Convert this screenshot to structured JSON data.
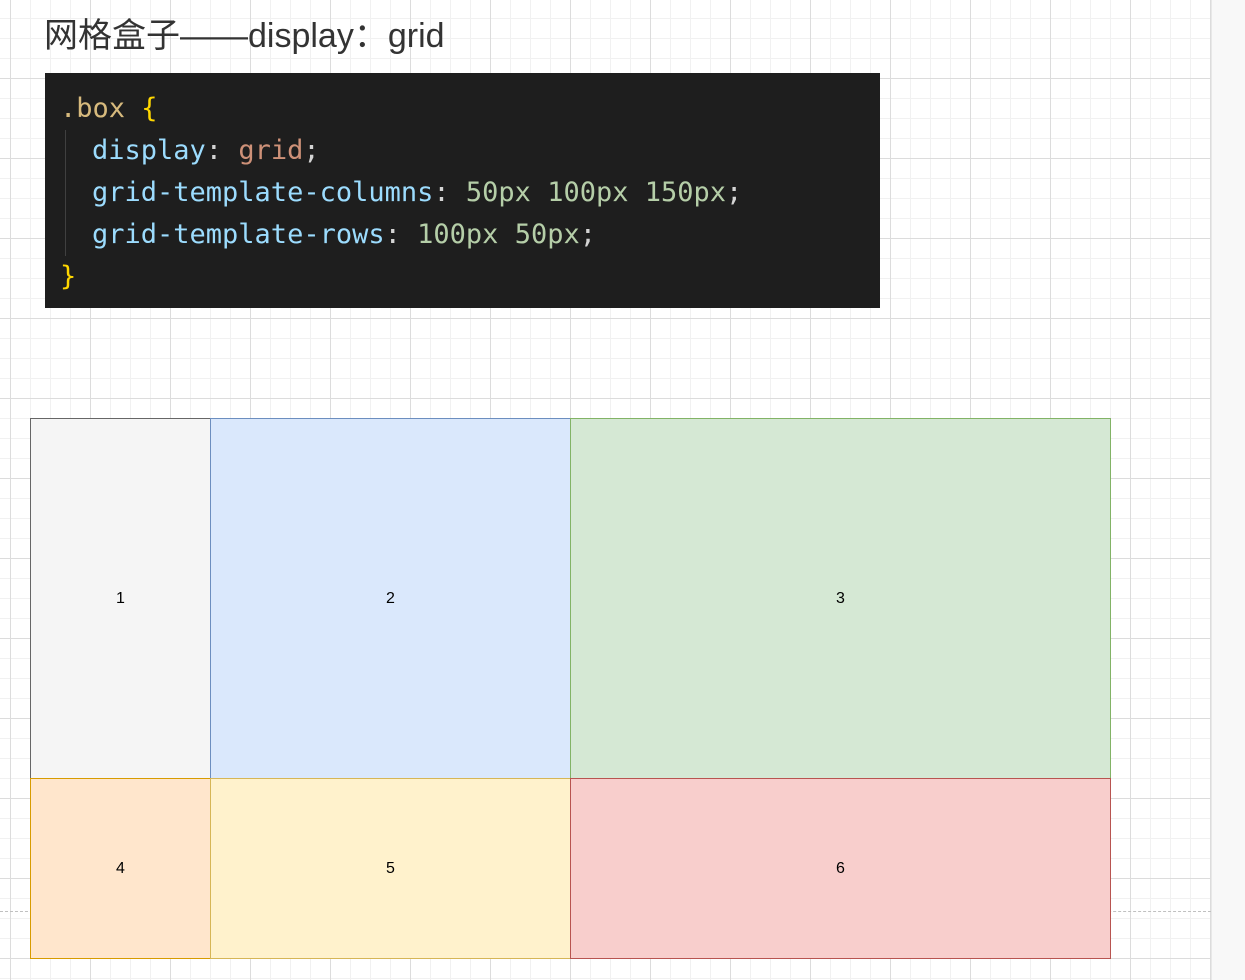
{
  "heading": "网格盒子——display：grid",
  "code": {
    "selector": ".box",
    "open_brace": "{",
    "close_brace": "}",
    "lines": [
      {
        "property": "display",
        "values": [
          {
            "text": "grid",
            "kind": "keyword"
          }
        ]
      },
      {
        "property": "grid-template-columns",
        "values": [
          {
            "text": "50px",
            "kind": "number"
          },
          {
            "text": "100px",
            "kind": "number"
          },
          {
            "text": "150px",
            "kind": "number"
          }
        ]
      },
      {
        "property": "grid-template-rows",
        "values": [
          {
            "text": "100px",
            "kind": "number"
          },
          {
            "text": "50px",
            "kind": "number"
          }
        ]
      }
    ]
  },
  "cells": [
    {
      "label": "1",
      "fill": "#f5f5f5",
      "stroke": "#666666"
    },
    {
      "label": "2",
      "fill": "#dae8fc",
      "stroke": "#6c8ebf"
    },
    {
      "label": "3",
      "fill": "#d5e8d4",
      "stroke": "#82b366"
    },
    {
      "label": "4",
      "fill": "#ffe6cc",
      "stroke": "#d79b00"
    },
    {
      "label": "5",
      "fill": "#fff2cc",
      "stroke": "#d6b656"
    },
    {
      "label": "6",
      "fill": "#f8cecc",
      "stroke": "#b85450"
    }
  ]
}
